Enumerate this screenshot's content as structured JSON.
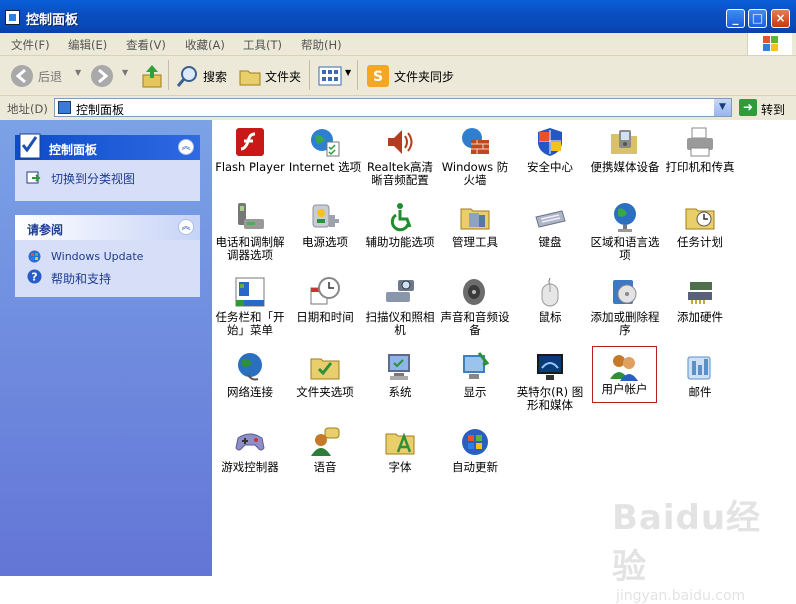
{
  "window": {
    "title": "控制面板",
    "buttons": [
      "_",
      "□",
      "×"
    ]
  },
  "menu": [
    "文件(F)",
    "编辑(E)",
    "查看(V)",
    "收藏(A)",
    "工具(T)",
    "帮助(H)"
  ],
  "toolbar": {
    "back": "后退",
    "search": "搜索",
    "folders": "文件夹",
    "sync": "文件夹同步"
  },
  "address": {
    "label": "地址(D)",
    "value": "控制面板",
    "go": "转到"
  },
  "sidebar": {
    "panel1": {
      "title": "控制面板",
      "link": "切换到分类视图"
    },
    "panel2": {
      "title": "请参阅",
      "links": [
        "Windows Update",
        "帮助和支持"
      ]
    }
  },
  "items": [
    {
      "label": "Flash Player",
      "icon": "flash-icon",
      "color": "#c81818"
    },
    {
      "label": "Internet 选项",
      "icon": "globe-icon",
      "color": "#2f7fd0"
    },
    {
      "label": "Realtek高清晰音频配置",
      "icon": "speaker-icon",
      "color": "#b53d1f"
    },
    {
      "label": "Windows 防火墙",
      "icon": "firewall-icon",
      "color": "#c0481d"
    },
    {
      "label": "安全中心",
      "icon": "shield-icon",
      "color": "#2457c5"
    },
    {
      "label": "便携媒体设备",
      "icon": "media-device-icon",
      "color": "#d9c06a"
    },
    {
      "label": "打印机和传真",
      "icon": "printer-icon",
      "color": "#8a8a8a"
    },
    {
      "label": "电话和调制解调器选项",
      "icon": "phone-icon",
      "color": "#777777"
    },
    {
      "label": "电源选项",
      "icon": "power-icon",
      "color": "#9da2ae"
    },
    {
      "label": "辅助功能选项",
      "icon": "accessibility-icon",
      "color": "#1f8d2e"
    },
    {
      "label": "管理工具",
      "icon": "admin-tools-icon",
      "color": "#d4a23a"
    },
    {
      "label": "键盘",
      "icon": "keyboard-icon",
      "color": "#9aa3b5"
    },
    {
      "label": "区域和语言选项",
      "icon": "region-globe-icon",
      "color": "#2b6fc0"
    },
    {
      "label": "任务计划",
      "icon": "task-folder-icon",
      "color": "#e0c050"
    },
    {
      "label": "任务栏和「开始」菜单",
      "icon": "taskbar-icon",
      "color": "#2a68c7"
    },
    {
      "label": "日期和时间",
      "icon": "clock-icon",
      "color": "#b0b0b0"
    },
    {
      "label": "扫描仪和照相机",
      "icon": "scanner-icon",
      "color": "#6e7a8c"
    },
    {
      "label": "声音和音频设备",
      "icon": "audio-icon",
      "color": "#6c6c6c"
    },
    {
      "label": "鼠标",
      "icon": "mouse-icon",
      "color": "#c9c9c9"
    },
    {
      "label": "添加或删除程序",
      "icon": "add-remove-icon",
      "color": "#3c78c4"
    },
    {
      "label": "添加硬件",
      "icon": "hardware-icon",
      "color": "#4f6f4a"
    },
    {
      "label": "网络连接",
      "icon": "network-icon",
      "color": "#2f8f3a"
    },
    {
      "label": "文件夹选项",
      "icon": "folder-options-icon",
      "color": "#e1c04b"
    },
    {
      "label": "系统",
      "icon": "system-icon",
      "color": "#5d6c8c"
    },
    {
      "label": "显示",
      "icon": "display-icon",
      "color": "#3e7fbf"
    },
    {
      "label": "英特尔(R) 图形和媒体",
      "icon": "intel-graphics-icon",
      "color": "#1a1a1a"
    },
    {
      "label": "用户帐户",
      "icon": "users-icon",
      "color": "#c47a2a"
    },
    {
      "label": "邮件",
      "icon": "mail-icon",
      "color": "#5a8fc8"
    },
    {
      "label": "游戏控制器",
      "icon": "gamepad-icon",
      "color": "#8f8fc8"
    },
    {
      "label": "语音",
      "icon": "speech-icon",
      "color": "#2e7d3a"
    },
    {
      "label": "字体",
      "icon": "fonts-folder-icon",
      "color": "#e1c04b"
    },
    {
      "label": "自动更新",
      "icon": "update-icon",
      "color": "#2a5fc0"
    }
  ],
  "selected_item": "用户帐户",
  "watermark": {
    "brand": "Baidu经验",
    "url": "jingyan.baidu.com"
  }
}
